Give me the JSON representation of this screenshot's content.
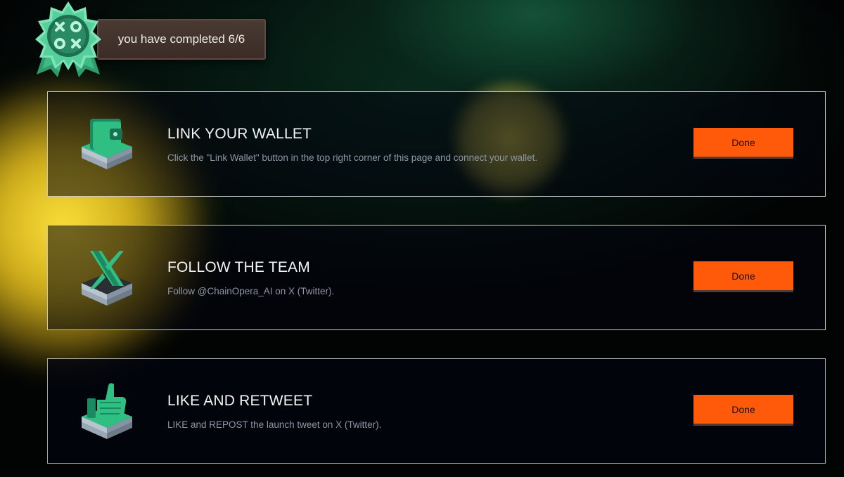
{
  "header": {
    "progress_text": "you have completed 6/6",
    "badge_icon": "xoxo-medal-icon"
  },
  "tasks": [
    {
      "icon": "wallet-icon",
      "title": "LINK YOUR WALLET",
      "description": "Click the \"Link Wallet\" button in the top right corner of this page and connect your wallet.",
      "button_label": "Done"
    },
    {
      "icon": "x-logo-icon",
      "title": "FOLLOW THE TEAM",
      "description": "Follow @ChainOpera_AI on X (Twitter).",
      "button_label": "Done"
    },
    {
      "icon": "thumbs-up-icon",
      "title": "LIKE AND RETWEET",
      "description": "LIKE and REPOST the launch tweet on X (Twitter).",
      "button_label": "Done"
    }
  ],
  "colors": {
    "accent_button": "#ff5a0a",
    "icon_green": "#2fbf83",
    "glow_yellow": "#f5d52a"
  }
}
